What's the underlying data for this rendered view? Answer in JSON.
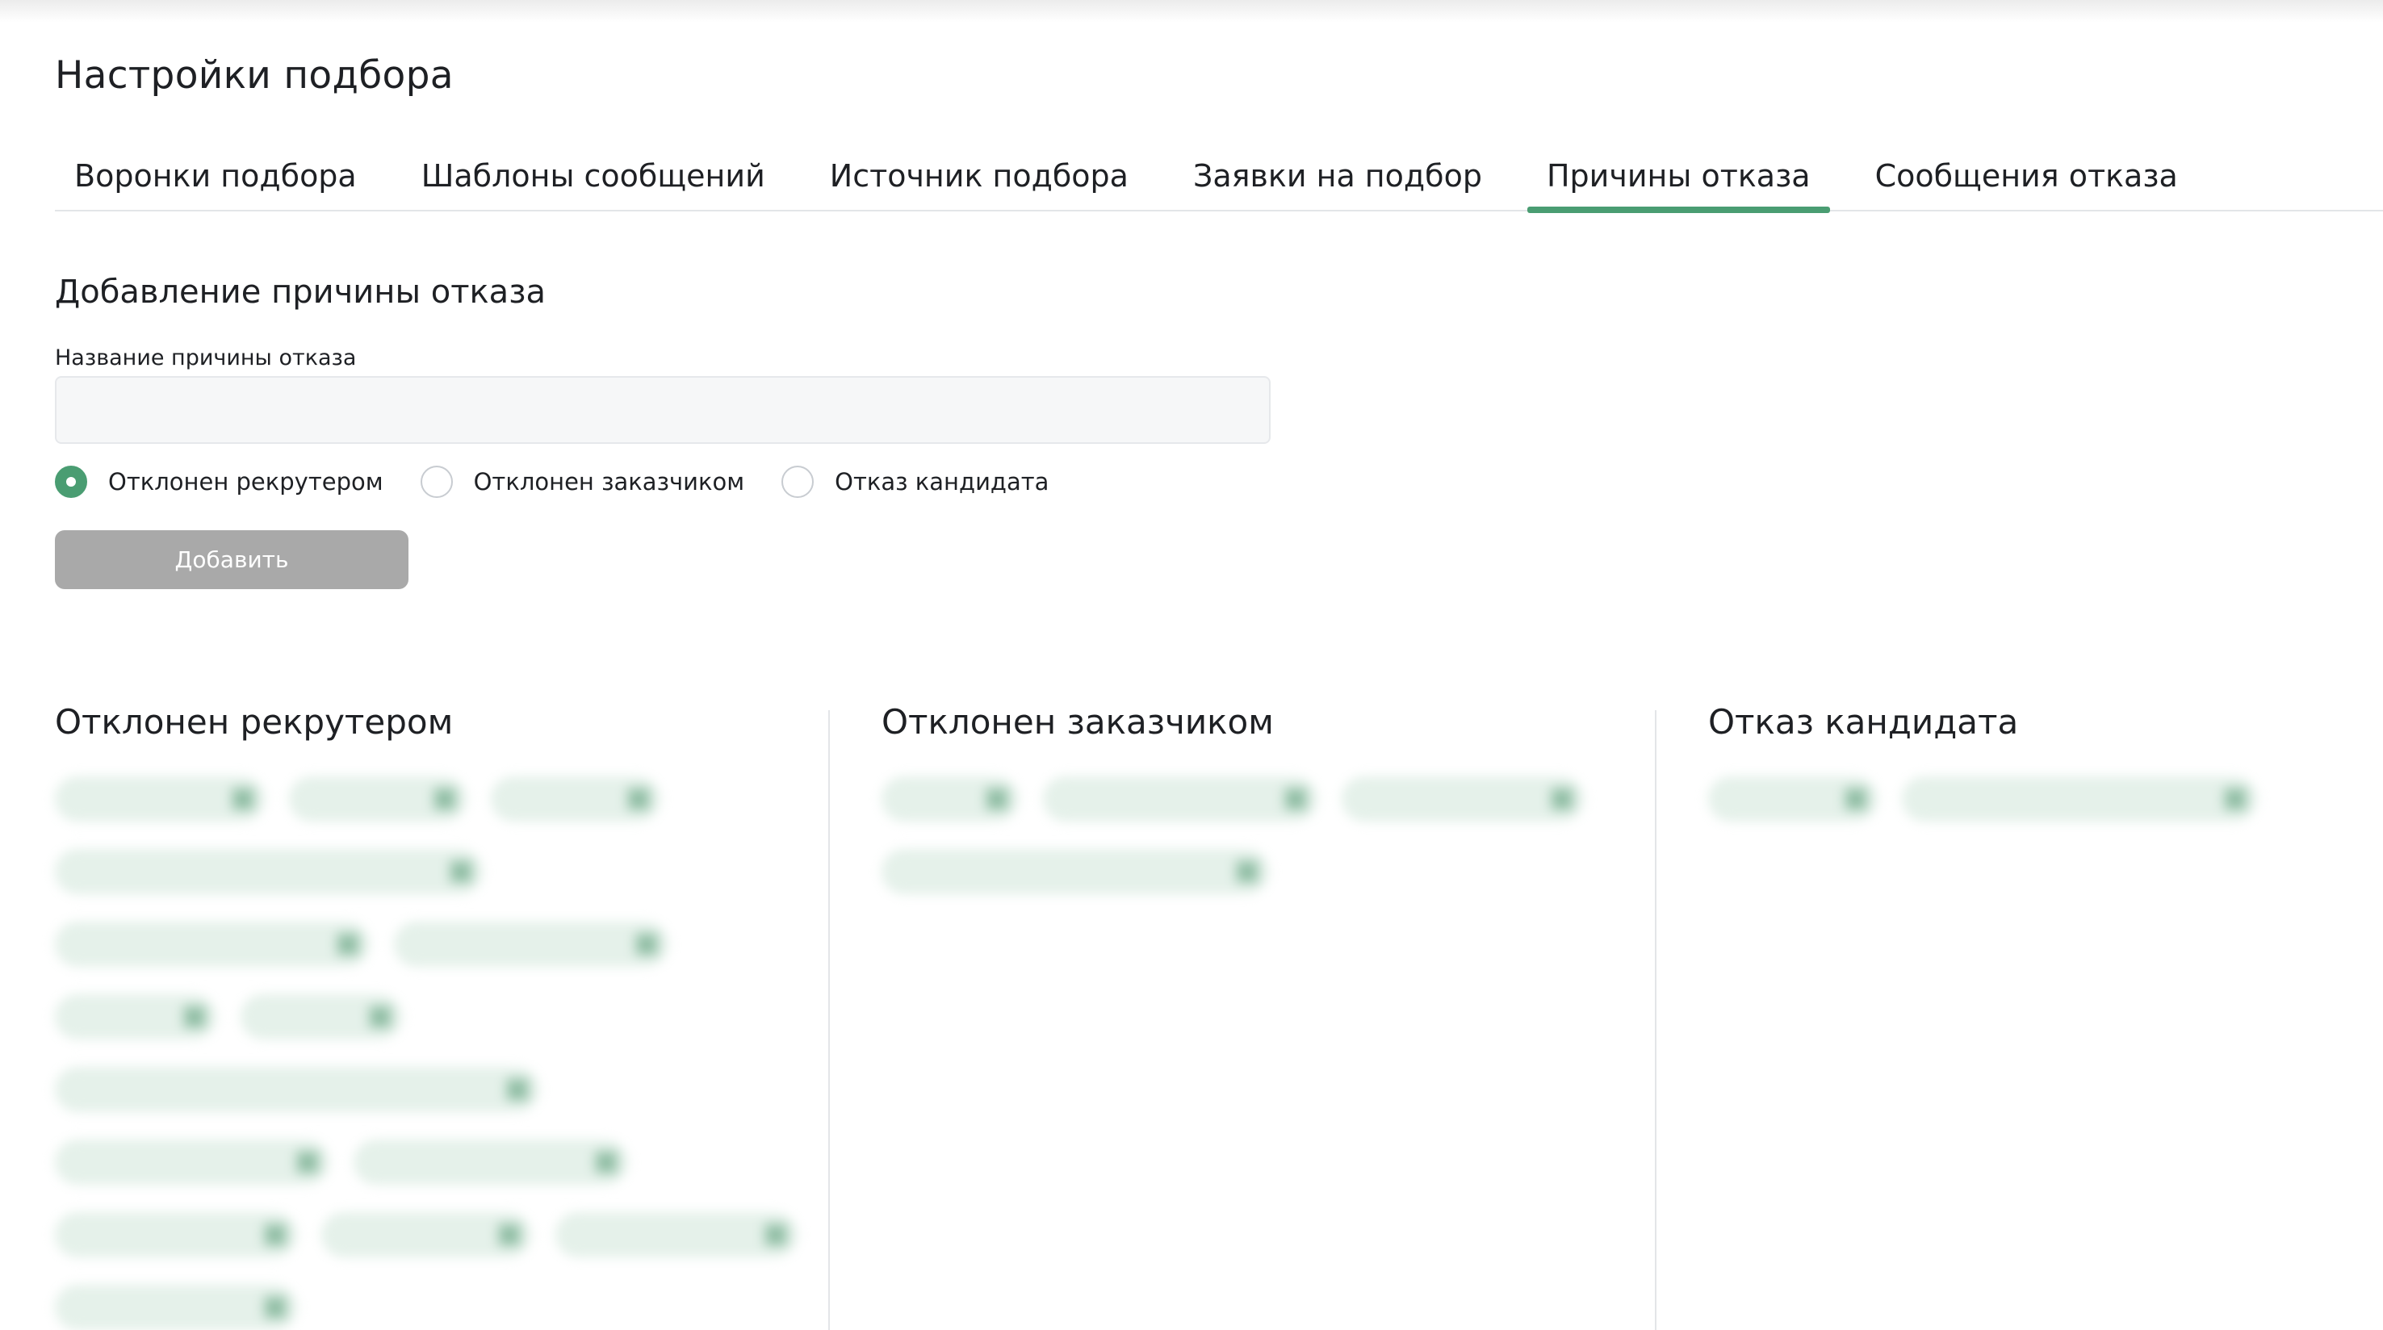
{
  "page_title": "Настройки подбора",
  "tabs": [
    {
      "label": "Воронки подбора",
      "active": false
    },
    {
      "label": "Шаблоны сообщений",
      "active": false
    },
    {
      "label": "Источник подбора",
      "active": false
    },
    {
      "label": "Заявки на подбор",
      "active": false
    },
    {
      "label": "Причины отказа",
      "active": true
    },
    {
      "label": "Сообщения отказа",
      "active": false
    }
  ],
  "form": {
    "title": "Добавление причины отказа",
    "field_label": "Название причины отказа",
    "field_value": "",
    "field_placeholder": "",
    "radio_options": [
      {
        "label": "Отклонен рекрутером",
        "checked": true
      },
      {
        "label": "Отклонен заказчиком",
        "checked": false
      },
      {
        "label": "Отказ кандидата",
        "checked": false
      }
    ],
    "submit_label": "Добавить"
  },
  "columns": [
    {
      "title": "Отклонен рекрутером",
      "chips": [
        "",
        "",
        "",
        "",
        "",
        "",
        "",
        "",
        "",
        "",
        "",
        "",
        "",
        "",
        ""
      ]
    },
    {
      "title": "Отклонен заказчиком",
      "chips": [
        "",
        "",
        "",
        ""
      ]
    },
    {
      "title": "Отказ кандидата",
      "chips": [
        "",
        ""
      ]
    }
  ],
  "colors": {
    "accent": "#4a9d72",
    "chip_background": "#e5f1ea",
    "button_disabled": "#a9a9a9"
  },
  "icons": {
    "chip_remove": "close-icon"
  }
}
